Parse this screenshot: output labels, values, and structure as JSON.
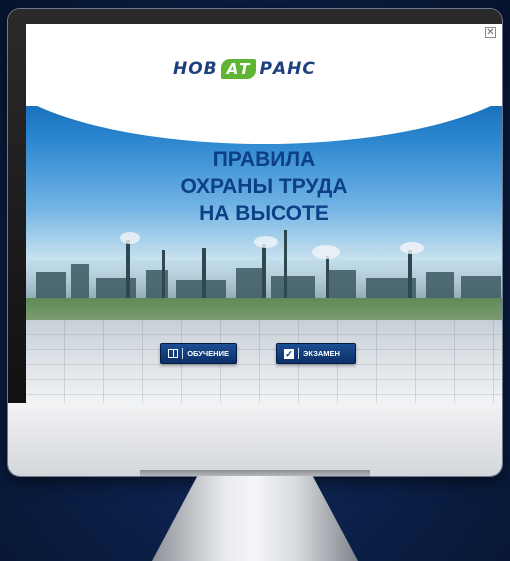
{
  "logo": {
    "left": "НОВ",
    "middle": "АТ",
    "right": "РАНС"
  },
  "title": {
    "line1": "ПРАВИЛА",
    "line2": "ОХРАНЫ ТРУДА",
    "line3": "НА ВЫСОТЕ"
  },
  "buttons": {
    "learn_label": "ОБУЧЕНИЕ",
    "exam_label": "ЭКЗАМЕН"
  },
  "close_label": "✕",
  "icons": {
    "close": "close-icon",
    "learn": "book-icon",
    "exam": "checkbox-icon"
  },
  "colors": {
    "title": "#0d3f86",
    "button": "#0b2f66",
    "logo_green": "#5fb533",
    "logo_blue": "#1e3f7d"
  }
}
